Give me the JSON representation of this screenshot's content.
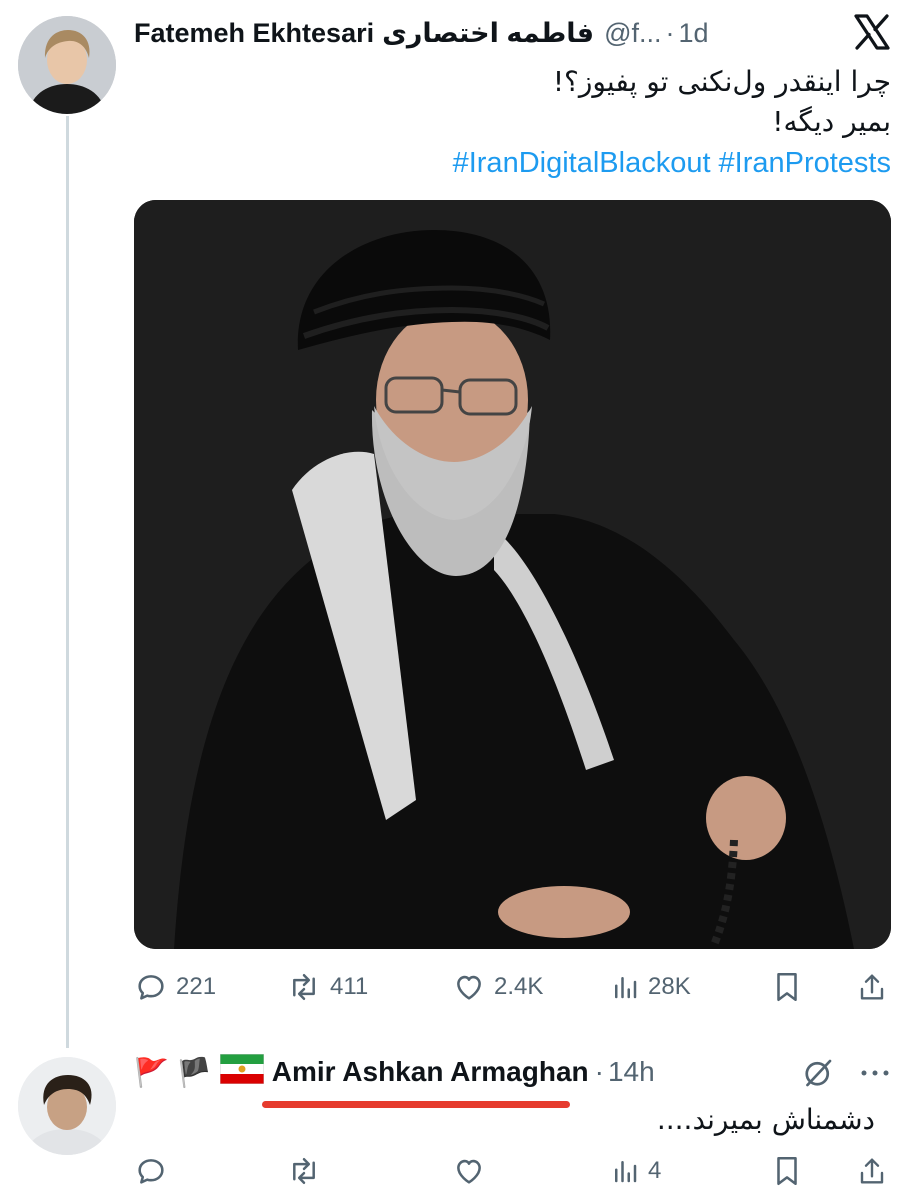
{
  "tweet": {
    "author_name": "Fatemeh Ekhtesari",
    "author_name_fa": "فاطمه اختصاری",
    "handle": "@f...",
    "separator": "·",
    "time": "1d",
    "text_line1": "چرا اینقدر ول‌نکنی تو پفیوز؟!",
    "text_line2": "بمیر دیگه!",
    "hashtags": [
      "#IranDigitalBlackout",
      "#IranProtests"
    ],
    "media_icon": "photo-of-man-in-black-turban",
    "stats": {
      "replies": "221",
      "reposts": "411",
      "likes": "2.4K",
      "views": "28K"
    }
  },
  "reply": {
    "flags": [
      "🚩",
      "🏴",
      "flag-iran-lion-sun"
    ],
    "author_name": "Amir Ashkan Armaghan",
    "separator": "·",
    "time": "14h",
    "text": "دشمناش بمیرند....",
    "stats": {
      "replies": "",
      "reposts": "",
      "likes": "",
      "views": "4"
    }
  },
  "colors": {
    "accent": "#1d9bf0",
    "secondary_text": "#536471",
    "thread_line": "#cfd9de",
    "highlight_underline": "#e63b2e"
  },
  "icons": [
    "x-logo-icon",
    "reply-icon",
    "repost-icon",
    "like-icon",
    "views-icon",
    "bookmark-icon",
    "share-icon",
    "grok-icon",
    "more-icon"
  ]
}
